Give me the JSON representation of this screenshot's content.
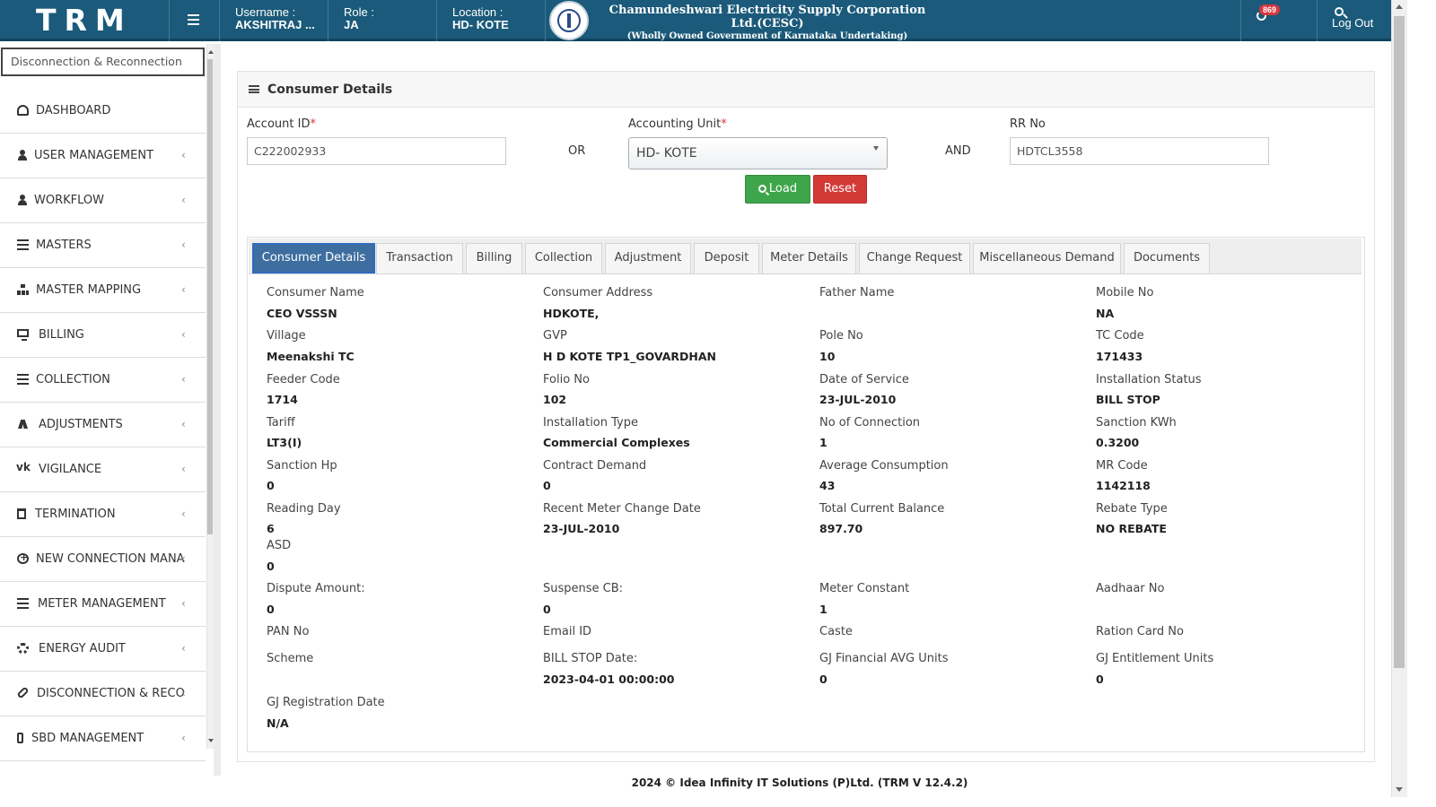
{
  "header": {
    "brand": "TRM",
    "username_label": "Username :",
    "username_value": "AKSHITRAJ ...",
    "role_label": "Role :",
    "role_value": "JA",
    "location_label": "Location :",
    "location_value": "HD- KOTE",
    "org_title": "Chamundeshwari Electricity Supply Corporation Ltd.(CESC)",
    "org_subtitle": "(Wholly Owned Government of Karnataka Undertaking)",
    "notification_count": "869",
    "logout_label": "Log Out"
  },
  "sidebar": {
    "search_value": "Disconnection & Reconnection",
    "items": [
      {
        "label": "DASHBOARD",
        "icon": "dashboard-icon"
      },
      {
        "label": "USER MANAGEMENT",
        "icon": "user-icon"
      },
      {
        "label": "WORKFLOW",
        "icon": "user-icon"
      },
      {
        "label": "MASTERS",
        "icon": "list-icon"
      },
      {
        "label": "MASTER MAPPING",
        "icon": "sitemap-icon"
      },
      {
        "label": "BILLING",
        "icon": "monitor-icon"
      },
      {
        "label": "COLLECTION",
        "icon": "list-icon"
      },
      {
        "label": "ADJUSTMENTS",
        "icon": "adjust-icon"
      },
      {
        "label": "VIGILANCE",
        "icon": "vk-icon"
      },
      {
        "label": "TERMINATION",
        "icon": "trash-icon"
      },
      {
        "label": "NEW CONNECTION MANAGEMENT",
        "icon": "plus-circle-icon"
      },
      {
        "label": "METER MANAGEMENT",
        "icon": "list-icon"
      },
      {
        "label": "ENERGY AUDIT",
        "icon": "gears-icon"
      },
      {
        "label": "DISCONNECTION & RECONNECTION",
        "icon": "link-icon"
      },
      {
        "label": "SBD MANAGEMENT",
        "icon": "mobile-icon"
      }
    ]
  },
  "panel": {
    "title": "Consumer Details",
    "account_id_label": "Account ID",
    "account_id_value": "C222002933",
    "or_label": "OR",
    "accounting_unit_label": "Accounting Unit",
    "accounting_unit_value": "HD- KOTE",
    "and_label": "AND",
    "rr_no_label": "RR No",
    "rr_no_value": "HDTCL3558",
    "load_label": "Load",
    "reset_label": "Reset",
    "required_mark": "*"
  },
  "tabs": [
    "Consumer Details",
    "Transaction",
    "Billing",
    "Collection",
    "Adjustment",
    "Deposit",
    "Meter Details",
    "Change Request",
    "Miscellaneous Demand",
    "Documents"
  ],
  "details": [
    {
      "label": "Consumer Name",
      "value": "CEO VSSSN"
    },
    {
      "label": "Consumer Address",
      "value": "HDKOTE,"
    },
    {
      "label": "Father Name",
      "value": ""
    },
    {
      "label": "Mobile No",
      "value": "NA"
    },
    {
      "label": "Village",
      "value": "Meenakshi TC"
    },
    {
      "label": "GVP",
      "value": "H D KOTE TP1_GOVARDHAN"
    },
    {
      "label": "Pole No",
      "value": "10"
    },
    {
      "label": "TC Code",
      "value": "171433"
    },
    {
      "label": "Feeder Code",
      "value": "1714"
    },
    {
      "label": "Folio No",
      "value": "102"
    },
    {
      "label": "Date of Service",
      "value": "23-JUL-2010"
    },
    {
      "label": "Installation Status",
      "value": "BILL STOP"
    },
    {
      "label": "Tariff",
      "value": "LT3(I)"
    },
    {
      "label": "Installation Type",
      "value": "Commercial Complexes"
    },
    {
      "label": "No of Connection",
      "value": "1"
    },
    {
      "label": "Sanction KWh",
      "value": "0.3200"
    },
    {
      "label": "Sanction Hp",
      "value": "0"
    },
    {
      "label": "Contract Demand",
      "value": "0"
    },
    {
      "label": "Average Consumption",
      "value": "43"
    },
    {
      "label": "MR Code",
      "value": "1142118"
    },
    {
      "label": "Reading Day",
      "value": "6"
    },
    {
      "label": "Recent Meter Change Date",
      "value": "23-JUL-2010"
    },
    {
      "label": "Total Current Balance",
      "value": "897.70"
    },
    {
      "label": "Rebate Type",
      "value": "NO REBATE"
    },
    {
      "label": "ASD",
      "value": "0"
    },
    {
      "label": "Dispute Amount:",
      "value": "0"
    },
    {
      "label": "Suspense CB:",
      "value": "0"
    },
    {
      "label": "Meter Constant",
      "value": "1"
    },
    {
      "label": "Aadhaar No",
      "value": ""
    },
    {
      "label": "PAN No",
      "value": ""
    },
    {
      "label": "Email ID",
      "value": ""
    },
    {
      "label": "Caste",
      "value": ""
    },
    {
      "label": "Ration Card No",
      "value": ""
    },
    {
      "label": "Scheme",
      "value": ""
    },
    {
      "label": "BILL STOP Date:",
      "value": "2023-04-01 00:00:00"
    },
    {
      "label": "GJ Financial AVG Units",
      "value": "0"
    },
    {
      "label": "GJ Entitlement Units",
      "value": "0"
    },
    {
      "label": "GJ Registration Date",
      "value": "N/A"
    }
  ],
  "footer": "2024 © Idea Infinity IT Solutions (P)Ltd. (TRM V 12.4.2)"
}
